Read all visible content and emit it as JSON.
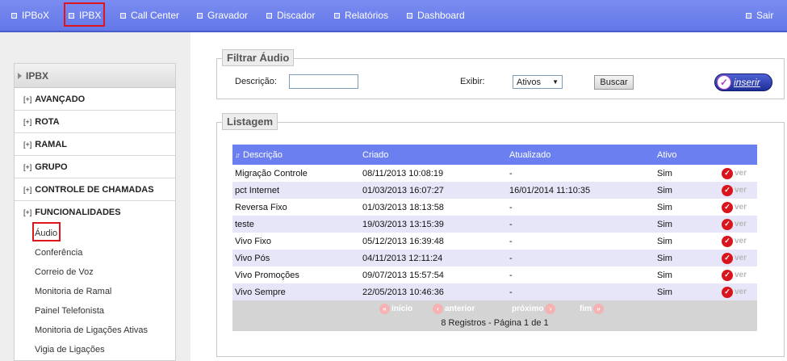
{
  "nav": {
    "items": [
      {
        "label": "IPBoX"
      },
      {
        "label": "IPBX"
      },
      {
        "label": "Call Center"
      },
      {
        "label": "Gravador"
      },
      {
        "label": "Discador"
      },
      {
        "label": "Relatórios"
      },
      {
        "label": "Dashboard"
      }
    ],
    "logout": "Sair"
  },
  "sidebar": {
    "title": "IPBX",
    "categories": [
      {
        "plus": "[+]",
        "label": "AVANÇADO"
      },
      {
        "plus": "[+]",
        "label": "ROTA"
      },
      {
        "plus": "[+]",
        "label": "RAMAL"
      },
      {
        "plus": "[+]",
        "label": "GRUPO"
      },
      {
        "plus": "[+]",
        "label": "CONTROLE DE CHAMADAS"
      },
      {
        "plus": "[+]",
        "label": "FUNCIONALIDADES"
      }
    ],
    "subitems": [
      {
        "label": "Áudio"
      },
      {
        "label": "Conferência"
      },
      {
        "label": "Correio de Voz"
      },
      {
        "label": "Monitoria de Ramal"
      },
      {
        "label": "Painel Telefonista"
      },
      {
        "label": "Monitoria de Ligações Ativas"
      },
      {
        "label": "Vigia de Ligações"
      }
    ]
  },
  "filter": {
    "legend": "Filtrar Áudio",
    "descricao_label": "Descrição:",
    "descricao_value": "",
    "exibir_label": "Exibir:",
    "exibir_value": "Ativos",
    "buscar_label": "Buscar",
    "inserir_label": "inserir"
  },
  "listing": {
    "legend": "Listagem",
    "columns": [
      "Descrição",
      "Criado",
      "Atualizado",
      "Ativo"
    ],
    "rows": [
      {
        "descricao": "Migração Controle",
        "criado": "08/11/2013 10:08:19",
        "atualizado": "-",
        "ativo": "Sim"
      },
      {
        "descricao": "pct Internet",
        "criado": "01/03/2013 16:07:27",
        "atualizado": "16/01/2014 11:10:35",
        "ativo": "Sim"
      },
      {
        "descricao": "Reversa Fixo",
        "criado": "01/03/2013 18:13:58",
        "atualizado": "-",
        "ativo": "Sim"
      },
      {
        "descricao": "teste",
        "criado": "19/03/2013 13:15:39",
        "atualizado": "-",
        "ativo": "Sim"
      },
      {
        "descricao": "Vivo Fixo",
        "criado": "05/12/2013 16:39:48",
        "atualizado": "-",
        "ativo": "Sim"
      },
      {
        "descricao": "Vivo Pós",
        "criado": "04/11/2013 12:11:24",
        "atualizado": "-",
        "ativo": "Sim"
      },
      {
        "descricao": "Vivo Promoções",
        "criado": "09/07/2013 15:57:54",
        "atualizado": "-",
        "ativo": "Sim"
      },
      {
        "descricao": "Vivo Sempre",
        "criado": "22/05/2013 10:46:36",
        "atualizado": "-",
        "ativo": "Sim"
      }
    ],
    "action_label": "ver",
    "pager": {
      "inicio": "início",
      "anterior": "anterior",
      "proximo": "próximo",
      "fim": "fim",
      "summary": "8 Registros - Página 1 de 1"
    }
  },
  "colors": {
    "nav_bg": "#6c7ff0",
    "header_row": "#6c7ff0",
    "alt_row": "#e6e6f8",
    "highlight_box": "#e0141c",
    "action_icon": "#d8141c"
  }
}
